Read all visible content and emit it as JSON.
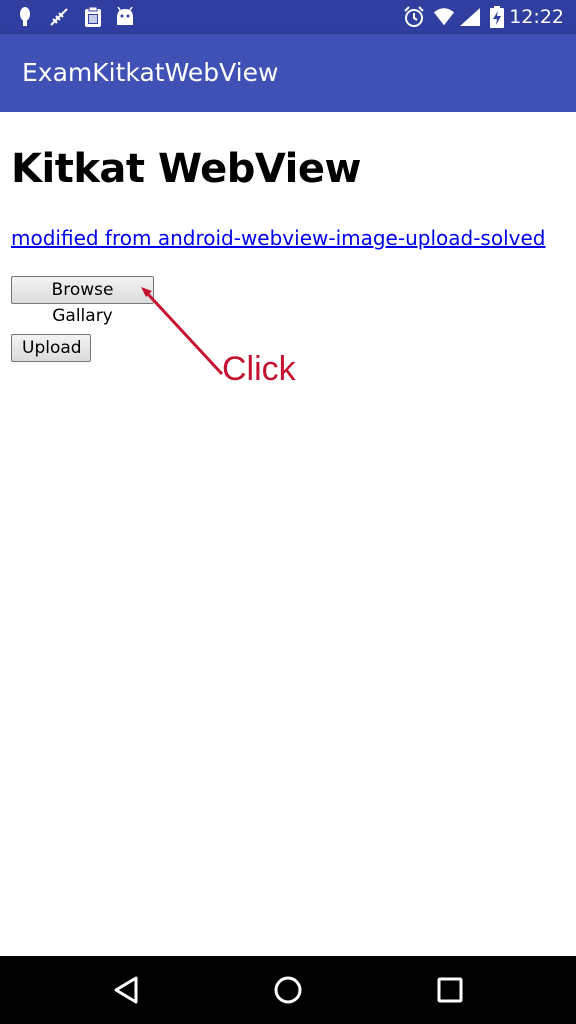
{
  "status_bar": {
    "time": "12:22",
    "left_icons": [
      "android-notification-icon",
      "signal-scan-icon",
      "clipboard-icon",
      "android-robot-icon"
    ],
    "right_icons": [
      "alarm-icon",
      "wifi-icon",
      "cell-signal-icon",
      "battery-charging-icon"
    ]
  },
  "app_bar": {
    "title": "ExamKitkatWebView"
  },
  "web_content": {
    "heading": "Kitkat WebView",
    "link_text": "modified from android-webview-image-upload-solved",
    "browse_button_label": "Browse Gallary",
    "upload_button_label": "Upload"
  },
  "annotation": {
    "label": "Click",
    "color": "#C41230"
  },
  "nav_bar": {
    "buttons": [
      "back-icon",
      "home-icon",
      "recents-icon"
    ]
  },
  "colors": {
    "status_bar": "#303F9F",
    "app_bar": "#3F51B5",
    "link": "#0000EE"
  }
}
